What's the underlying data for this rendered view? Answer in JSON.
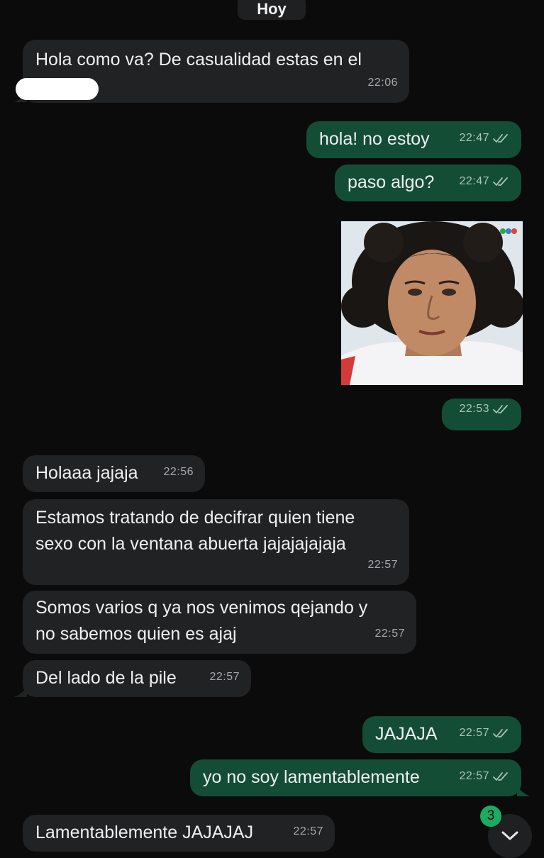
{
  "day_separator": "Hoy",
  "messages": [
    {
      "text": "Hola como va? De casualidad estas en el",
      "time": "22:06"
    },
    {
      "text": "hola! no estoy",
      "time": "22:47"
    },
    {
      "text": "paso algo?",
      "time": "22:47"
    },
    {
      "text": "",
      "time": "22:53"
    },
    {
      "text": "Holaaa jajaja",
      "time": "22:56"
    },
    {
      "text": "Estamos tratando de decifrar quien tiene\nsexo con la ventana abuerta jajajajajaja",
      "time": "22:57"
    },
    {
      "text": "Somos varios q ya nos venimos qejando y\nno sabemos quien es ajaj",
      "time": "22:57"
    },
    {
      "text": "Del lado de la pile",
      "time": "22:57"
    },
    {
      "text": "JAJAJA",
      "time": "22:57"
    },
    {
      "text": "yo no soy lamentablemente",
      "time": "22:57"
    },
    {
      "text": "Lamentablemente JAJAJAJ",
      "time": "22:57"
    }
  ],
  "unread_badge": "3",
  "icons": {
    "read_receipt": "double-check-icon",
    "scroll_down": "chevron-down-icon"
  },
  "colors": {
    "incoming": "#202223",
    "outgoing": "#144d36",
    "background": "#0b0b0c",
    "badge": "#1daa61"
  }
}
